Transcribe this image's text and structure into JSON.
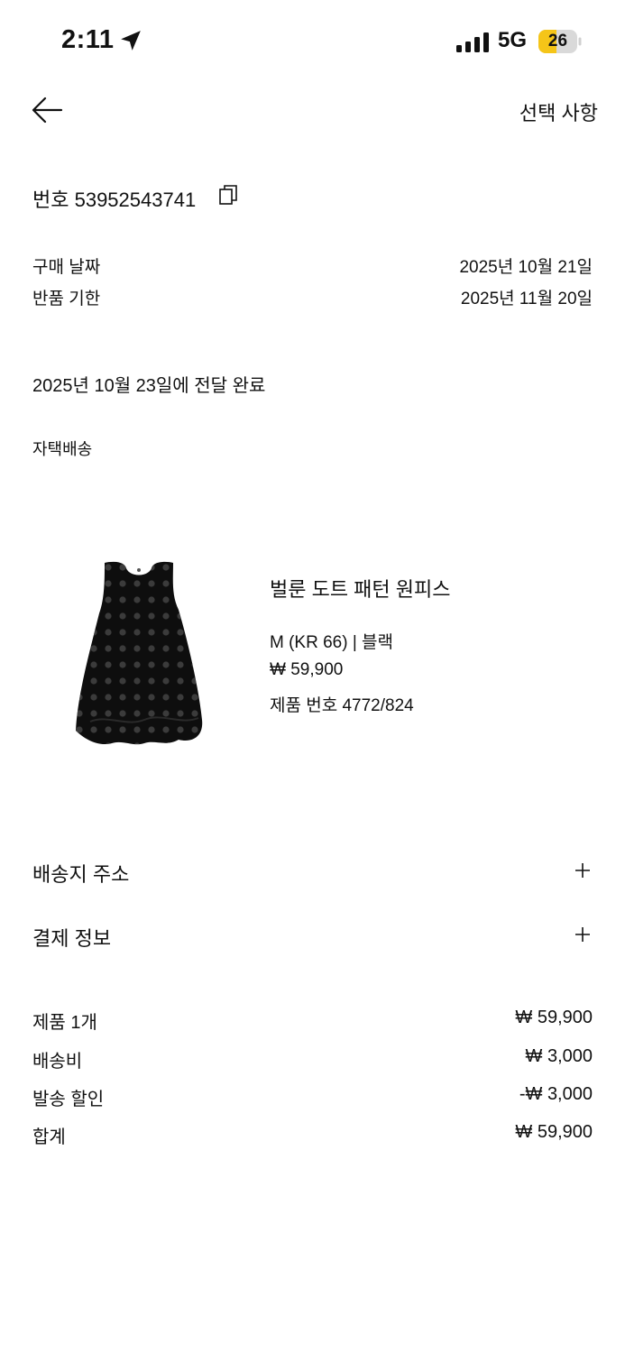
{
  "status_bar": {
    "time": "2:11",
    "network": "5G",
    "battery": "26",
    "battery_color": "#f5c518"
  },
  "header": {
    "back_icon": "arrow-left-icon",
    "options_label": "선택 사항"
  },
  "order": {
    "number_label": "번호 53952543741",
    "copy_icon": "copy-icon",
    "purchase_date_label": "구매 날짜",
    "purchase_date_value": "2025년 10월 21일",
    "return_deadline_label": "반품 기한",
    "return_deadline_value": "2025년 11월 20일",
    "delivery_status": "2025년 10월 23일에 전달 완료",
    "delivery_method": "자택배송"
  },
  "product": {
    "name": "벌룬 도트 패턴 원피스",
    "size_color": "M (KR 66) | 블랙",
    "price": "₩ 59,900",
    "product_code": "제품 번호 4772/824"
  },
  "sections": [
    {
      "label": "배송지 주소",
      "icon": "plus-icon"
    },
    {
      "label": "결제 정보",
      "icon": "plus-icon"
    }
  ],
  "summary": [
    {
      "label": "제품 1개",
      "value": "₩ 59,900"
    },
    {
      "label": "배송비",
      "value": "₩ 3,000"
    },
    {
      "label": "발송 할인",
      "value": "-₩ 3,000"
    },
    {
      "label": "합계",
      "value": "₩ 59,900"
    }
  ]
}
